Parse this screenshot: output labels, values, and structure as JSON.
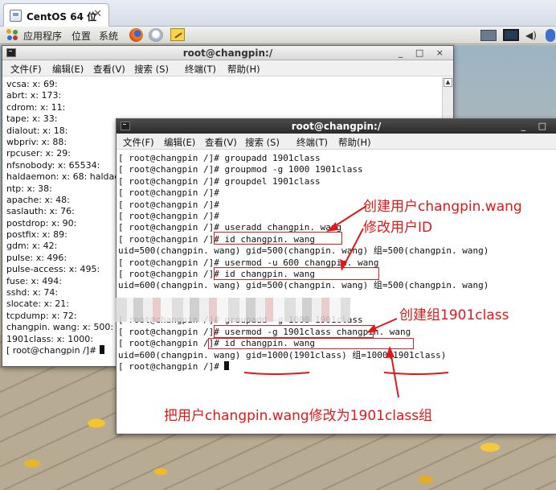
{
  "vm_tab": {
    "title": "CentOS 64 位",
    "close": "✕"
  },
  "panel": {
    "applications": "应用程序",
    "places": "位置",
    "system": "系统",
    "launchers": [
      "firefox-icon",
      "help-icon",
      "text-editor-icon"
    ],
    "tray": [
      "network-icon",
      "display-icon",
      "volume-icon",
      "bluetooth-icon"
    ]
  },
  "terminal_back": {
    "title": "root@changpin:/",
    "controls": "_ □ ×",
    "menu": [
      "文件(F)",
      "编辑(E)",
      "查看(V)",
      "搜索 (S)",
      "终端(T)",
      "帮助(H)"
    ],
    "lines": [
      "vcsa: x: 69:",
      "abrt: x: 173:",
      "cdrom: x: 11:",
      "tape: x: 33:",
      "dialout: x: 18:",
      "wbpriv: x: 88:",
      "rpcuser: x: 29:",
      "nfsnobody: x: 65534:",
      "haldaemon: x: 68: haldaemon",
      "ntp: x: 38:",
      "apache: x: 48:",
      "saslauth: x: 76:",
      "postdrop: x: 90:",
      "postfix: x: 89:",
      "gdm: x: 42:",
      "pulse: x: 496:",
      "pulse-access: x: 495:",
      "fuse: x: 494:",
      "sshd: x: 74:",
      "slocate: x: 21:",
      "tcpdump: x: 72:",
      "changpin. wang: x: 500:",
      "1901class: x: 1000:",
      "[ root@changpin /]# "
    ]
  },
  "terminal_front": {
    "title": "root@changpin:/",
    "controls": "_ □",
    "menu": [
      "文件(F)",
      "编辑(E)",
      "查看(V)",
      "搜索 (S)",
      "终端(T)",
      "帮助(H)"
    ],
    "lines": [
      "[ root@changpin /]# groupadd 1901class",
      "[ root@changpin /]# groupmod -g 1000 1901class",
      "[ root@changpin /]# groupdel 1901class",
      "[ root@changpin /]#",
      "[ root@changpin /]#",
      "[ root@changpin /]#",
      "[ root@changpin /]# useradd changpin. wang",
      "[ root@changpin /]# id changpin. wang",
      "uid=500(changpin. wang) gid=500(changpin. wang) 组=500(changpin. wang)",
      "[ root@changpin /]# usermod -u 600 changpin. wang",
      "[ root@changpin /]# id changpin. wang",
      "uid=600(changpin. wang) gid=500(changpin. wang) 组=500(changpin. wang)",
      "",
      "",
      "[ root@changpin /]# groupadd -g 1000 1901class",
      "[ root@changpin /]# usermod -g 1901class changpin. wang",
      "[ root@changpin /]# id changpin. wang",
      "uid=600(changpin. wang) gid=1000(1901class) 组=1000(1901class)",
      "[ root@changpin /]# "
    ]
  },
  "annotations": {
    "create_user": "创建用户changpin.wang",
    "modify_uid": "修改用户ID",
    "create_group": "创建组1901class",
    "change_group": "把用户changpin.wang修改为1901class组",
    "color": "#e01818"
  }
}
